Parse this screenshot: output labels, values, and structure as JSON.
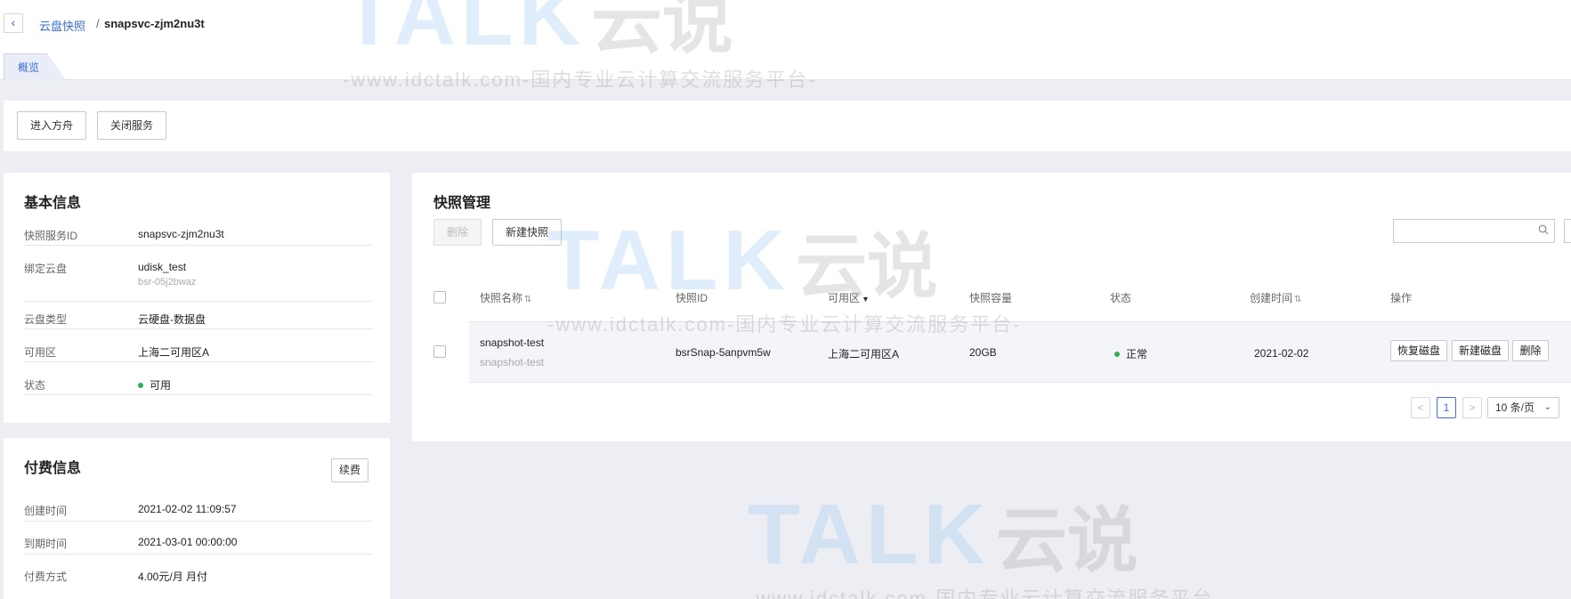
{
  "breadcrumb": {
    "parent": "云盘快照",
    "separator": "/",
    "current": "snapsvc-zjm2nu3t"
  },
  "tabs": {
    "overview": "概览"
  },
  "actions": {
    "enter_ark": "进入方舟",
    "close_service": "关闭服务"
  },
  "basic_info": {
    "title": "基本信息",
    "rows": [
      {
        "label": "快照服务ID",
        "value": "snapsvc-zjm2nu3t"
      },
      {
        "label": "绑定云盘",
        "value": "udisk_test",
        "sub": "bsr-05j2bwaz"
      },
      {
        "label": "云盘类型",
        "value": "云硬盘-数据盘"
      },
      {
        "label": "可用区",
        "value": "上海二可用区A"
      },
      {
        "label": "状态",
        "value": "可用"
      }
    ]
  },
  "billing": {
    "title": "付费信息",
    "renew_label": "续费",
    "rows": [
      {
        "label": "创建时间",
        "value": "2021-02-02 11:09:57"
      },
      {
        "label": "到期时间",
        "value": "2021-03-01 00:00:00"
      },
      {
        "label": "付费方式",
        "value": "4.00元/月 月付"
      }
    ]
  },
  "snapshots": {
    "title": "快照管理",
    "delete_label": "删除",
    "new_label": "新建快照",
    "columns": [
      "快照名称",
      "快照ID",
      "可用区",
      "快照容量",
      "状态",
      "创建时间",
      "操作"
    ],
    "rows": [
      {
        "name": "snapshot-test",
        "desc": "snapshot-test",
        "id": "bsrSnap-5anpvm5w",
        "zone": "上海二可用区A",
        "size": "20GB",
        "status": "正常",
        "created": "2021-02-02",
        "ops": [
          "恢复磁盘",
          "新建磁盘",
          "删除"
        ]
      }
    ],
    "pagination": {
      "prev": "<",
      "page": "1",
      "next": ">",
      "page_size": "10 条/页"
    }
  },
  "watermark": {
    "brand": "TALK",
    "cn": "云说",
    "url": "-www.idctalk.com-国内专业云计算交流服务平台-"
  },
  "colors": {
    "accent": "#3a6fd8",
    "status_ok": "#2bb24c"
  }
}
